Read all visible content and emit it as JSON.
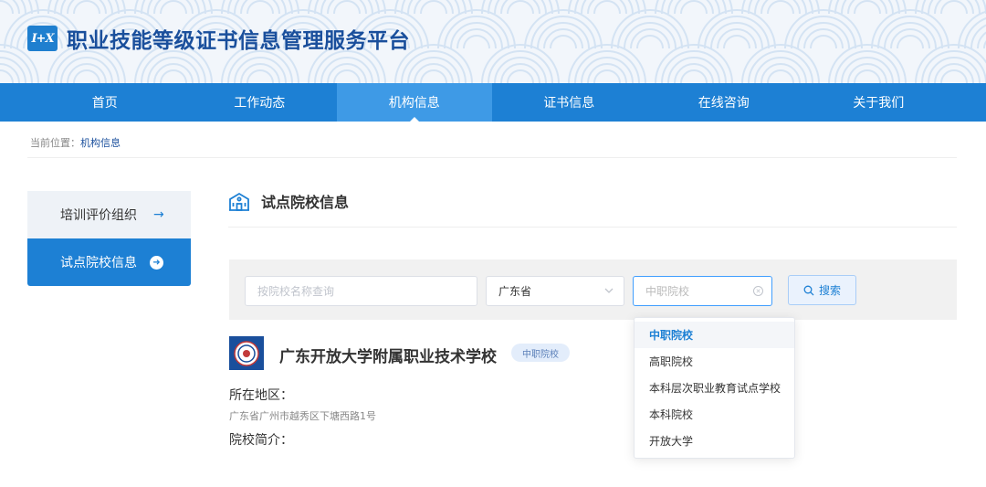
{
  "header": {
    "logo_text": "I+X",
    "site_title": "职业技能等级证书信息管理服务平台"
  },
  "nav": {
    "items": [
      {
        "label": "首页"
      },
      {
        "label": "工作动态"
      },
      {
        "label": "机构信息",
        "active": true
      },
      {
        "label": "证书信息"
      },
      {
        "label": "在线咨询"
      },
      {
        "label": "关于我们"
      }
    ]
  },
  "breadcrumb": {
    "prefix": "当前位置：",
    "current": "机构信息"
  },
  "sidebar": {
    "items": [
      {
        "label": "培训评价组织",
        "active": false
      },
      {
        "label": "试点院校信息",
        "active": true
      }
    ]
  },
  "section": {
    "title": "试点院校信息"
  },
  "search": {
    "name_placeholder": "按院校名称查询",
    "province_value": "广东省",
    "type_placeholder": "中职院校",
    "button_label": "搜索"
  },
  "dropdown": {
    "options": [
      {
        "label": "中职院校",
        "selected": true
      },
      {
        "label": "高职院校"
      },
      {
        "label": "本科层次职业教育试点学校"
      },
      {
        "label": "本科院校"
      },
      {
        "label": "开放大学"
      }
    ]
  },
  "result": {
    "school_name": "广东开放大学附属职业技术学校",
    "badge": "中职院校",
    "region_label": "所在地区：",
    "region_value": "广东省广州市越秀区下塘西路1号",
    "intro_label": "院校简介："
  },
  "colors": {
    "primary": "#1d80d4",
    "nav_active": "#3e9ae6",
    "title_blue": "#1a4f9c"
  }
}
